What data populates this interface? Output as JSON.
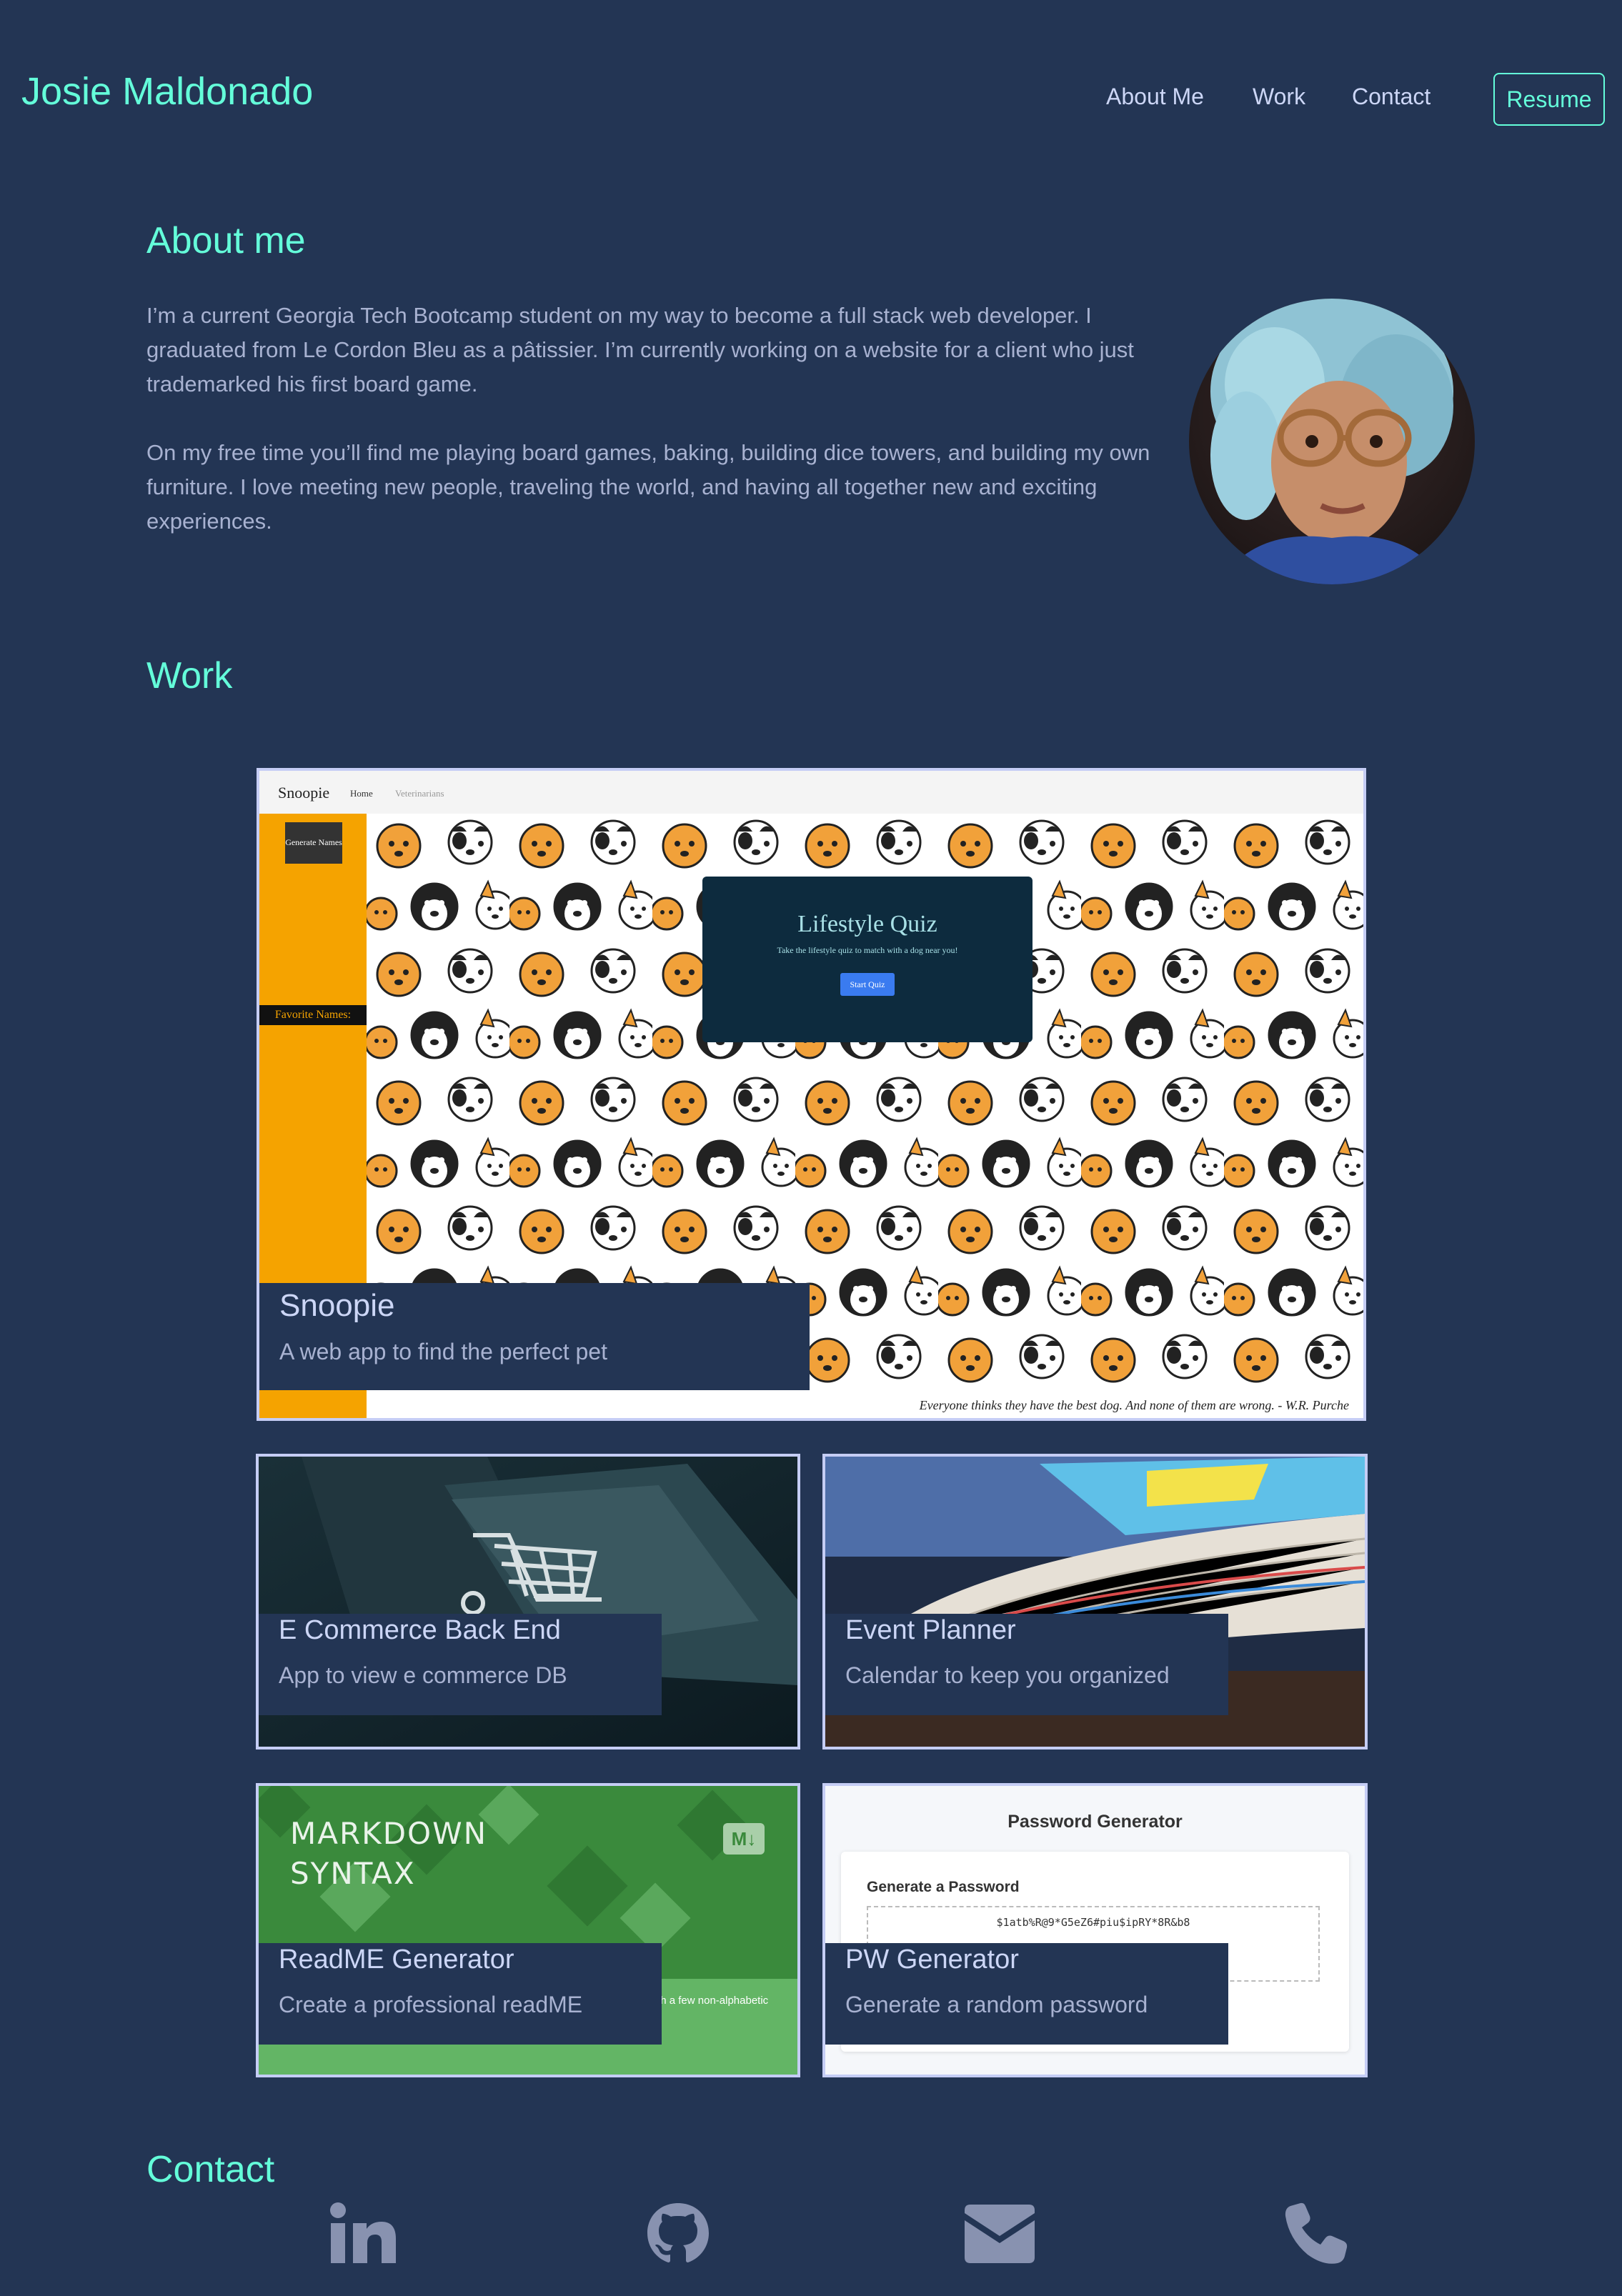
{
  "nav": {
    "brand": "Josie Maldonado",
    "links": [
      "About Me",
      "Work",
      "Contact"
    ],
    "resume": "Resume"
  },
  "about": {
    "title": "About me",
    "p1": "I’m a current Georgia Tech Bootcamp student on my way to become a full stack web developer. I graduated from Le Cordon Bleu as a pâtissier. I’m currently working on a website for a client who just trademarked his first board game.",
    "p2": "On my free time you’ll find me playing board games, baking, building dice towers, and building my own furniture. I love meeting new people, traveling the world, and having all together new and exciting experiences."
  },
  "work": {
    "title": "Work",
    "featured": {
      "title": "Snoopie",
      "desc": "A web app to find the perfect pet",
      "screenshot": {
        "brand": "Snoopie",
        "nav": [
          "Home",
          "Veterinarians"
        ],
        "generate": "Generate Names",
        "favorites": "Favorite Names:",
        "quiz_title": "Lifestyle Quiz",
        "quiz_sub": "Take the lifestyle quiz to match with a dog near you!",
        "quiz_btn": "Start Quiz",
        "quote": "Everyone thinks they have the best dog. And none of them are wrong. - W.R. Purche"
      }
    },
    "projects": [
      {
        "title": "E Commerce Back End",
        "desc": "App to view e commerce DB"
      },
      {
        "title": "Event Planner",
        "desc": "Calendar to keep you organized"
      },
      {
        "title": "ReadME Generator",
        "desc": "Create a professional readME",
        "thumb": {
          "line1": "MARKDOWN",
          "line2": "SYNTAX",
          "badge": "M↓",
          "text": "...formatting words as ...th Markdown. Mostly, Markdown is just regular text with a few non-alphabetic characters thrown in, like # or *."
        }
      },
      {
        "title": "PW Generator",
        "desc": "Generate a random password",
        "thumb": {
          "heading": "Password Generator",
          "sub": "Generate a Password",
          "pw": "$1atb%R@9*G5eZ6#piu$ipRY*8R&b8"
        }
      }
    ]
  },
  "contact": {
    "title": "Contact",
    "icons": [
      "linkedin-icon",
      "github-icon",
      "envelope-icon",
      "phone-icon"
    ]
  },
  "colors": {
    "bg": "#233554",
    "accent": "#64ffda",
    "text": "#a8b2d1",
    "heading": "#ccd6f6",
    "border": "#c5cdf5"
  }
}
